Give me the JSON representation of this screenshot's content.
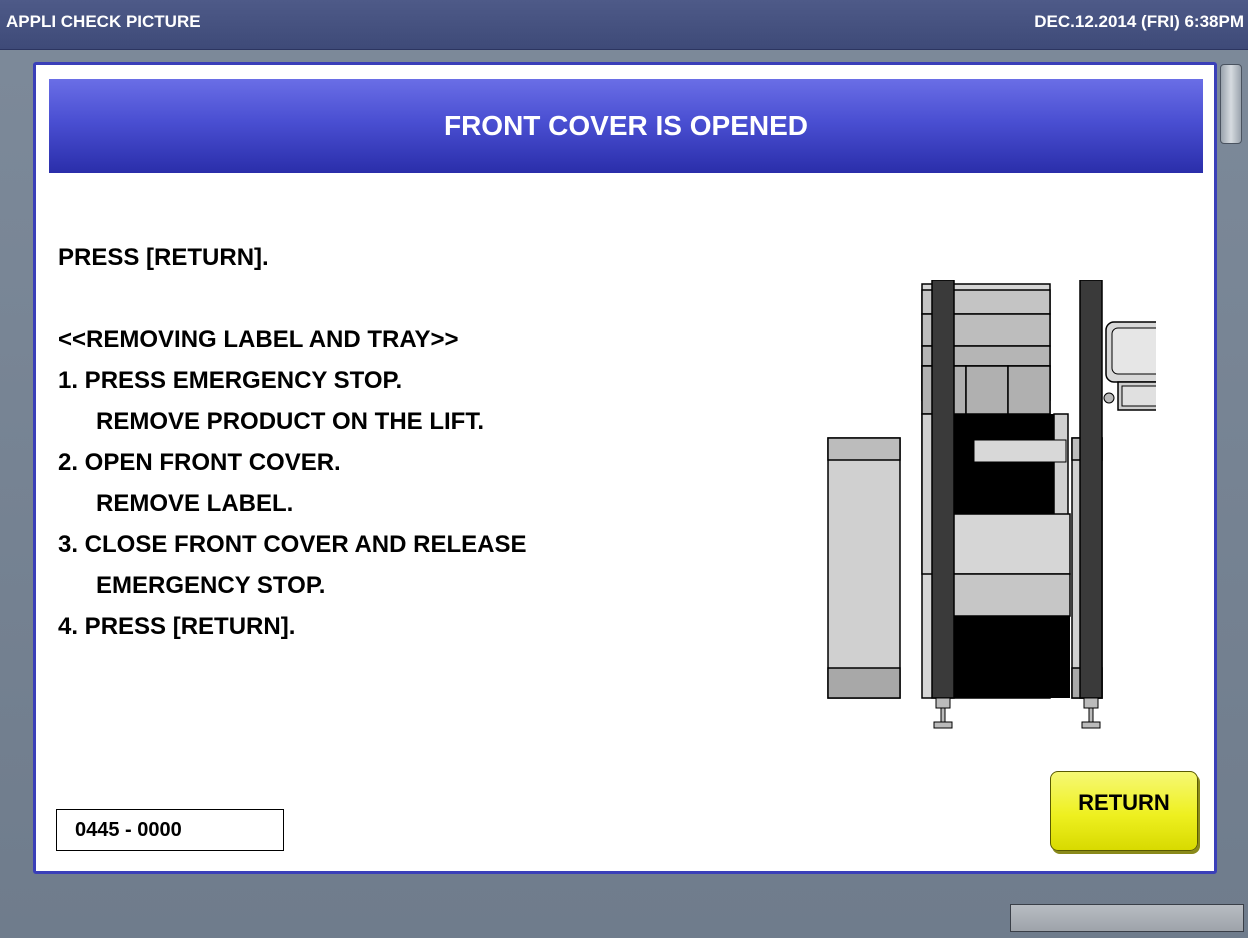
{
  "titlebar": {
    "app_title": "APPLI CHECK PICTURE",
    "datetime": "DEC.12.2014 (FRI)   6:38PM"
  },
  "dialog": {
    "title": "FRONT COVER IS OPENED",
    "lines": {
      "l1": "PRESS [RETURN].",
      "l2": "<<REMOVING LABEL AND TRAY>>",
      "l3": "1. PRESS EMERGENCY STOP.",
      "l4": "REMOVE PRODUCT ON THE LIFT.",
      "l5": "2. OPEN FRONT COVER.",
      "l6": "REMOVE LABEL.",
      "l7": "3. CLOSE FRONT COVER AND RELEASE",
      "l8": "EMERGENCY STOP.",
      "l9": "4. PRESS [RETURN]."
    },
    "code": "0445 - 0000",
    "return_label": "RETURN"
  },
  "colors": {
    "header_blue": "#4a4fd2",
    "dialog_border": "#3a3fb8",
    "button_yellow": "#eef020",
    "titlebar": "#46528a"
  },
  "icons": {
    "machine": "labeler-machine-illustration"
  }
}
